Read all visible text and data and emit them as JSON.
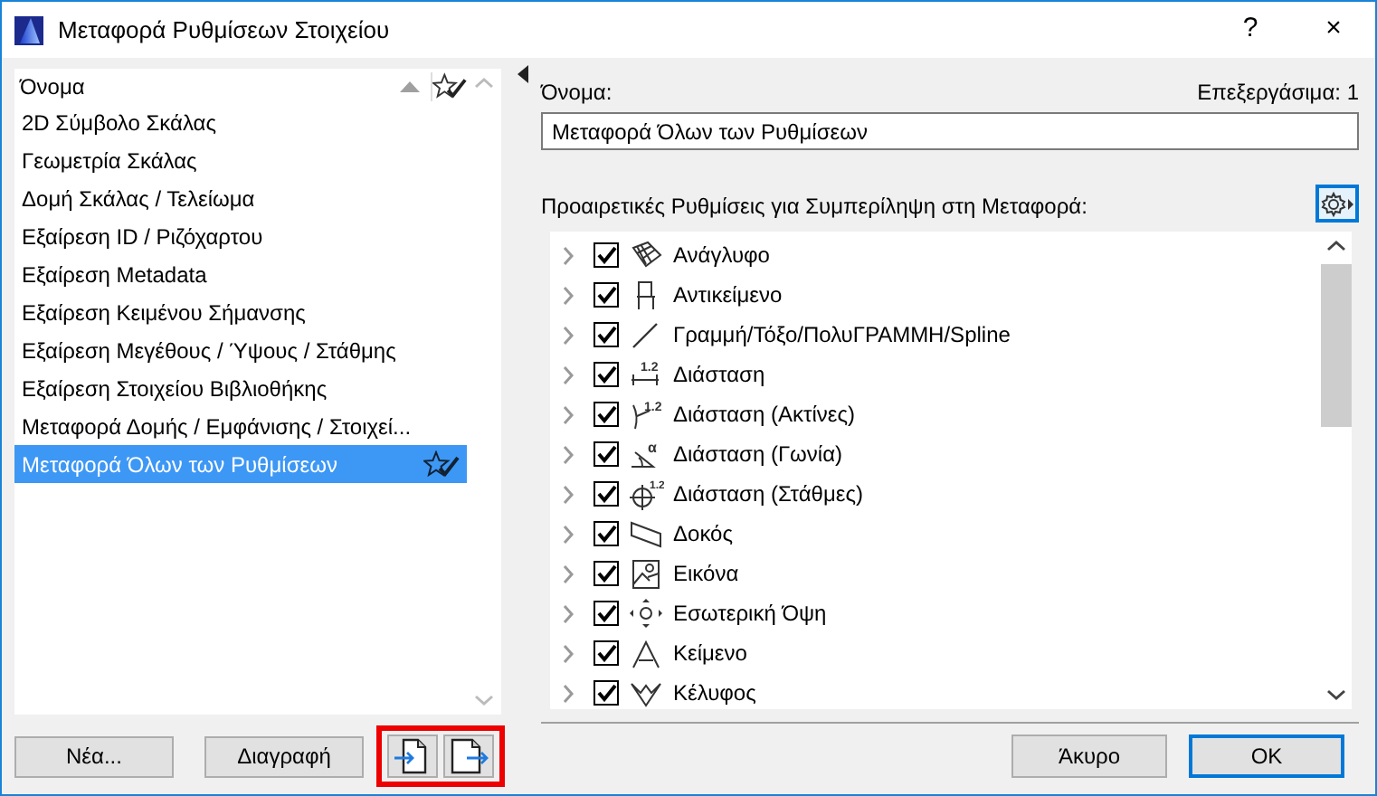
{
  "window": {
    "title": "Μεταφορά Ρυθμίσεων Στοιχείου",
    "help": "?",
    "close": "×"
  },
  "list": {
    "header": "Όνομα",
    "items": [
      {
        "label": "2D Σύμβολο Σκάλας",
        "selected": false
      },
      {
        "label": "Γεωμετρία Σκάλας",
        "selected": false
      },
      {
        "label": "Δομή Σκάλας / Τελείωμα",
        "selected": false
      },
      {
        "label": "Εξαίρεση ID / Ριζόχαρτου",
        "selected": false
      },
      {
        "label": "Εξαίρεση Metadata",
        "selected": false
      },
      {
        "label": "Εξαίρεση Κειμένου Σήμανσης",
        "selected": false
      },
      {
        "label": "Εξαίρεση Μεγέθους / Ύψους / Στάθμης",
        "selected": false
      },
      {
        "label": "Εξαίρεση Στοιχείου Βιβλιοθήκης",
        "selected": false
      },
      {
        "label": "Μεταφορά Δομής / Εμφάνισης / Στοιχεί...",
        "selected": false
      },
      {
        "label": "Μεταφορά Όλων των Ρυθμίσεων",
        "selected": true
      }
    ]
  },
  "left_buttons": [
    "Νέα...",
    "Διαγραφή"
  ],
  "name_label": "Όνομα:",
  "editable": "Επεξεργάσιμα: 1",
  "name_value": "Μεταφορά Όλων των Ρυθμίσεων",
  "options_label": "Προαιρετικές Ρυθμίσεις για Συμπερίληψη στη Μεταφορά:",
  "options": [
    {
      "kind": "mesh",
      "label": "Ανάγλυφο",
      "checked": true
    },
    {
      "kind": "chair",
      "label": "Αντικείμενο",
      "checked": true
    },
    {
      "kind": "line",
      "label": "Γραμμή/Τόξο/ΠολυΓΡΑΜΜΗ/Spline",
      "checked": true
    },
    {
      "kind": "dimension",
      "icon_text": "1.2",
      "label": "Διάσταση",
      "checked": true
    },
    {
      "kind": "radial",
      "icon_text": "1.2",
      "label": "Διάσταση (Ακτίνες)",
      "checked": true
    },
    {
      "kind": "angle",
      "icon_text": "α",
      "label": "Διάσταση (Γωνία)",
      "checked": true
    },
    {
      "kind": "level",
      "icon_text": "1.2",
      "label": "Διάσταση (Στάθμες)",
      "checked": true
    },
    {
      "kind": "beam",
      "label": "Δοκός",
      "checked": true
    },
    {
      "kind": "image",
      "label": "Εικόνα",
      "checked": true
    },
    {
      "kind": "elevation",
      "label": "Εσωτερική Όψη",
      "checked": true
    },
    {
      "kind": "text",
      "label": "Κείμενο",
      "checked": true
    },
    {
      "kind": "shell",
      "label": "Κέλυφος",
      "checked": true
    }
  ],
  "buttons": [
    "Άκυρο",
    "OK"
  ]
}
